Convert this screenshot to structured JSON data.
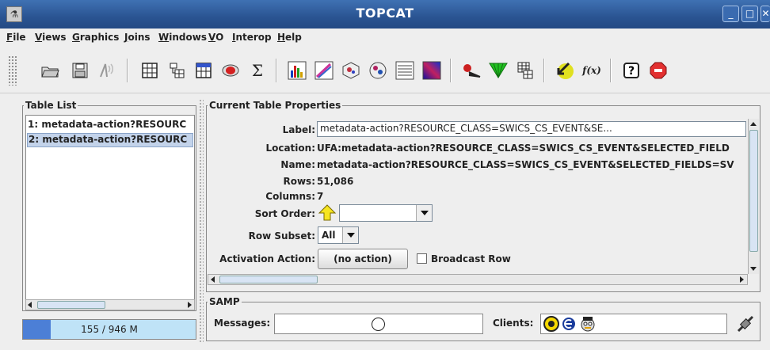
{
  "window": {
    "title": "TOPCAT"
  },
  "menu": [
    {
      "label": "File",
      "mnemonic": "F"
    },
    {
      "label": "Views",
      "mnemonic": "V"
    },
    {
      "label": "Graphics",
      "mnemonic": "G"
    },
    {
      "label": "Joins",
      "mnemonic": "J"
    },
    {
      "label": "Windows",
      "mnemonic": "W"
    },
    {
      "label": "VO",
      "mnemonic": "V"
    },
    {
      "label": "Interop",
      "mnemonic": "I"
    },
    {
      "label": "Help",
      "mnemonic": "H"
    }
  ],
  "toolbar": {
    "icons": [
      "open-folder-icon",
      "save-icon",
      "broadcast-icon",
      "table-data-icon",
      "table-meta-icon",
      "column-info-icon",
      "subset-icon",
      "statistics-icon",
      "histogram-icon",
      "plot2d-icon",
      "plot3d-icon",
      "sphere-icon",
      "stack-icon",
      "density-icon",
      "match-icon",
      "concat-icon",
      "cone-icon",
      "sky-icon",
      "function-icon",
      "help-icon",
      "stop-icon"
    ],
    "sigma": "Σ",
    "fx": "f(x)"
  },
  "table_list": {
    "title": "Table List",
    "items": [
      {
        "label": "1: metadata-action?RESOURC",
        "selected": false
      },
      {
        "label": "2: metadata-action?RESOURC",
        "selected": true
      }
    ],
    "memory": "155 / 946 M",
    "memory_fraction": 0.16
  },
  "properties": {
    "title": "Current Table Properties",
    "label_label": "Label:",
    "label_value": "metadata-action?RESOURCE_CLASS=SWICS_CS_EVENT&SE...",
    "location_label": "Location:",
    "location_value": "UFA:metadata-action?RESOURCE_CLASS=SWICS_CS_EVENT&SELECTED_FIELD",
    "name_label": "Name:",
    "name_value": "metadata-action?RESOURCE_CLASS=SWICS_CS_EVENT&SELECTED_FIELDS=SV",
    "rows_label": "Rows:",
    "rows_value": "51,086",
    "columns_label": "Columns:",
    "columns_value": "7",
    "sort_label": "Sort Order:",
    "sort_value": "",
    "subset_label": "Row Subset:",
    "subset_value": "All",
    "activation_label": "Activation Action:",
    "activation_value": "(no action)",
    "broadcast_label": "Broadcast Row",
    "broadcast_checked": false
  },
  "samp": {
    "title": "SAMP",
    "messages_label": "Messages:",
    "clients_label": "Clients:"
  },
  "colors": {
    "selection": "#c3d3ea",
    "memory_bar": "#4c7fd6",
    "memory_bg": "#bfe3f7",
    "stop": "#e23030"
  }
}
